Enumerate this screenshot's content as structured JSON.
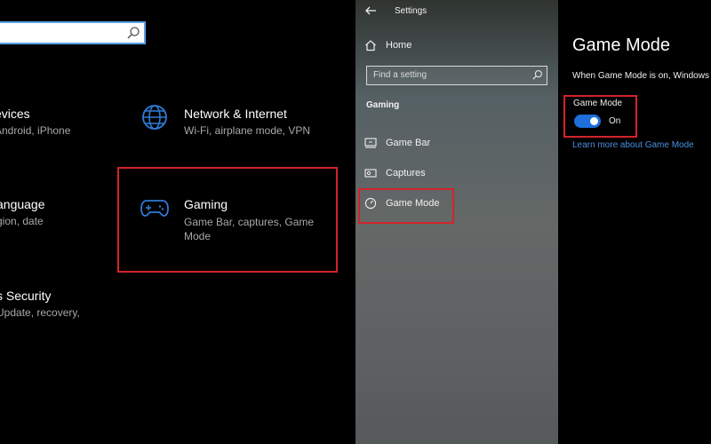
{
  "left": {
    "search": {
      "value": ""
    },
    "devices": {
      "title": "evices",
      "desc": "Android, iPhone"
    },
    "network": {
      "title": "Network & Internet",
      "desc": "Wi-Fi, airplane mode, VPN"
    },
    "language": {
      "title": "anguage",
      "desc": "gion, date"
    },
    "gaming": {
      "title": "Gaming",
      "desc_line1": "Game Bar, captures, Game",
      "desc_line2": "Mode"
    },
    "security": {
      "title": "s Security",
      "desc": "Update, recovery,"
    }
  },
  "middle": {
    "title": "Settings",
    "home_label": "Home",
    "search_placeholder": "Find a setting",
    "section_title": "Gaming",
    "nav_items": [
      {
        "label": "Game Bar"
      },
      {
        "label": "Captures"
      },
      {
        "label": "Game Mode"
      }
    ]
  },
  "right": {
    "title": "Game Mode",
    "description": "When Game Mode is on, Windows",
    "setting_label": "Game Mode",
    "toggle_state": "On",
    "link_text": "Learn more about Game Mode"
  },
  "colors": {
    "highlight_red": "#d2232a",
    "accent_blue": "#1e6fd9",
    "link_blue": "#4a90e2"
  }
}
